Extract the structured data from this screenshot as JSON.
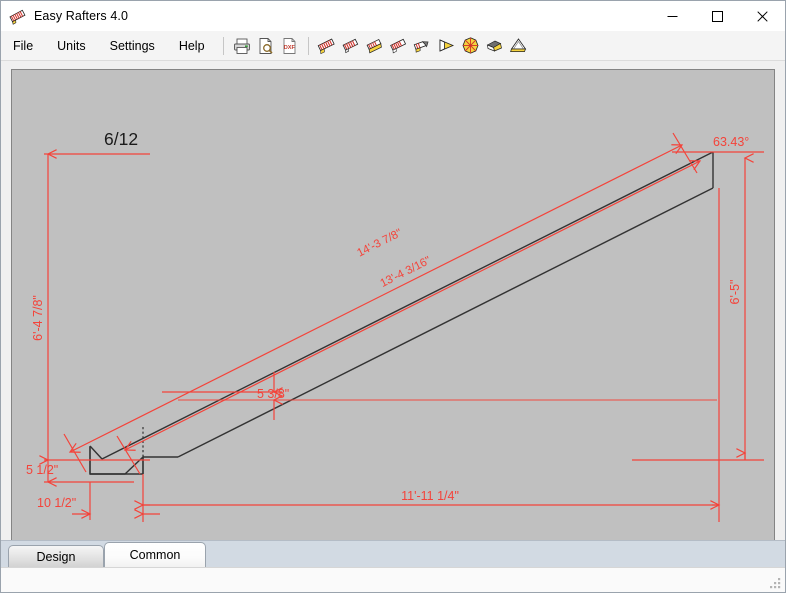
{
  "window": {
    "title": "Easy Rafters 4.0",
    "icon": "rafter-icon",
    "controls": {
      "minimize_label": "—",
      "maximize_label": "□",
      "close_label": "✕",
      "minimize_name": "minimize-button",
      "maximize_name": "maximize-button",
      "close_name": "close-button"
    }
  },
  "menu": {
    "items": [
      {
        "label": "File",
        "name": "menu-file"
      },
      {
        "label": "Units",
        "name": "menu-units"
      },
      {
        "label": "Settings",
        "name": "menu-settings"
      },
      {
        "label": "Help",
        "name": "menu-help"
      }
    ]
  },
  "toolbar": {
    "groups": [
      {
        "buttons": [
          {
            "name": "print-icon",
            "tip": "Print"
          },
          {
            "name": "print-preview-icon",
            "tip": "Print Preview"
          },
          {
            "name": "dxf-export-icon",
            "tip": "DXF"
          }
        ]
      },
      {
        "buttons": [
          {
            "name": "common-rafter-icon",
            "tip": "Common Rafter"
          },
          {
            "name": "hip-rafter-icon",
            "tip": "Hip Rafter"
          },
          {
            "name": "valley-rafter-icon",
            "tip": "Valley Rafter"
          },
          {
            "name": "jack-rafter-icon",
            "tip": "Jack Rafter"
          },
          {
            "name": "rafter-cut-icon",
            "tip": "Rafter Cut"
          },
          {
            "name": "wedge-icon",
            "tip": "Wedge"
          },
          {
            "name": "polygon-roof-icon",
            "tip": "Polygon Roof"
          },
          {
            "name": "ridge-beam-icon",
            "tip": "Ridge Beam"
          },
          {
            "name": "stack-icon",
            "tip": "Stack"
          }
        ]
      }
    ]
  },
  "drawing": {
    "pitch_label": "6/12",
    "angle_label": "63.43°",
    "dimensions": {
      "left_rise": "6'-4 7/8\"",
      "heel_height": "5 1/2\"",
      "tail_run": "10 1/2\"",
      "upper_diagonal": "14'-3 7/8\"",
      "lower_diagonal": "13'-4 3/16\"",
      "plumb_offset": "5 3/8\"",
      "right_rise": "6'-5\"",
      "bottom_run": "11'-11 1/4\""
    },
    "colors": {
      "background": "#c0c0c0",
      "dimension": "#f4433a",
      "outline": "#333333",
      "pitch_text": "#1a1a1a"
    }
  },
  "tabs": [
    {
      "label": "Design",
      "name": "tab-design",
      "active": false
    },
    {
      "label": "Common",
      "name": "tab-common",
      "active": true
    }
  ],
  "status": {
    "text": "",
    "grip": "resize-grip"
  }
}
